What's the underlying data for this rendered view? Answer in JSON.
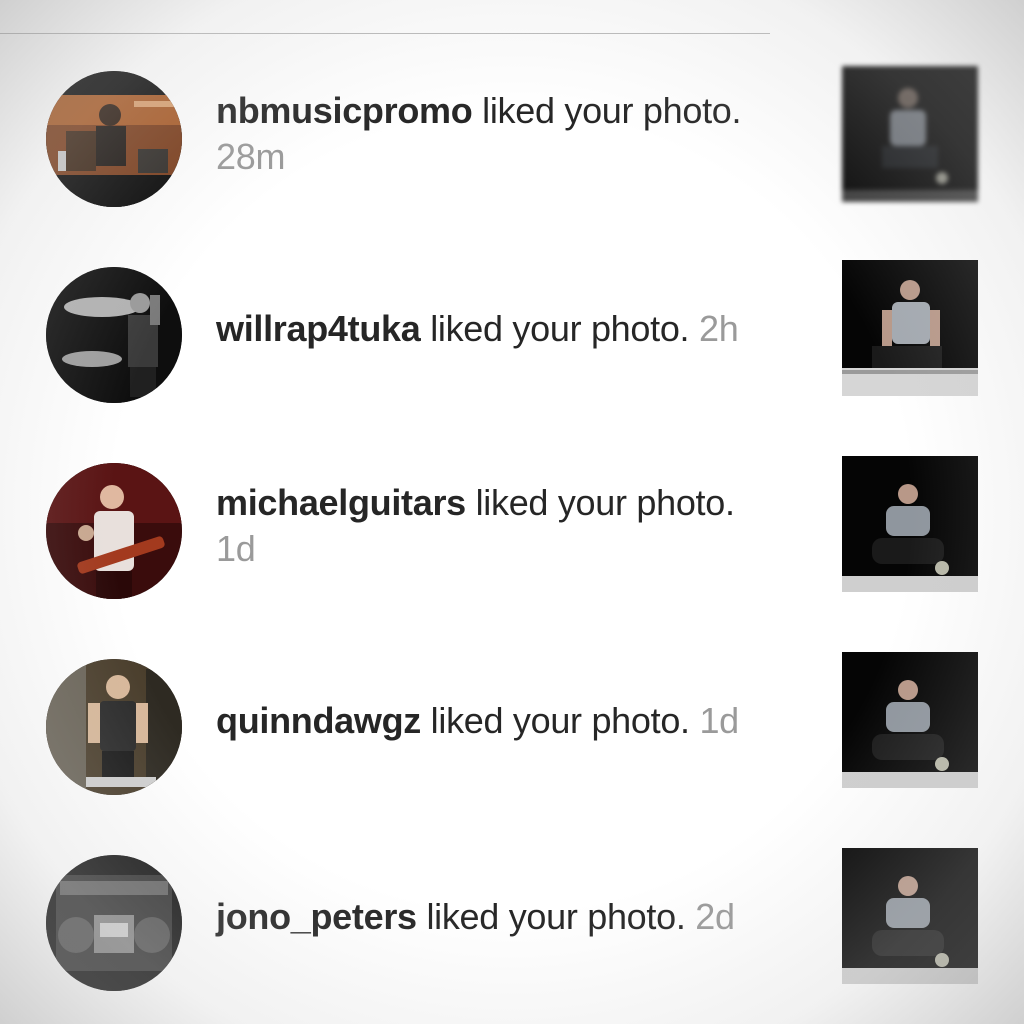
{
  "notifications": [
    {
      "username": "nbmusicpromo",
      "action": "liked your photo.",
      "time": "28m",
      "avatar": "studio-photo",
      "thumbnail": "man-sitting-photo"
    },
    {
      "username": "willrap4tuka",
      "action": "liked your photo.",
      "time": "2h",
      "avatar": "stage-performer-photo",
      "thumbnail": "man-sitting-photo"
    },
    {
      "username": "michaelguitars",
      "action": "liked your photo.",
      "time": "1d",
      "avatar": "guitarist-photo",
      "thumbnail": "man-crouching-photo"
    },
    {
      "username": "quinndawgz",
      "action": "liked your photo.",
      "time": "1d",
      "avatar": "mirror-selfie-photo",
      "thumbnail": "man-crouching-photo"
    },
    {
      "username": "jono_peters",
      "action": "liked your photo.",
      "time": "2d",
      "avatar": "boombox-photo",
      "thumbnail": "man-crouching-photo"
    }
  ],
  "colors": {
    "username": "#262626",
    "action": "#262626",
    "time": "#9a9a9a",
    "background": "#ffffff"
  }
}
